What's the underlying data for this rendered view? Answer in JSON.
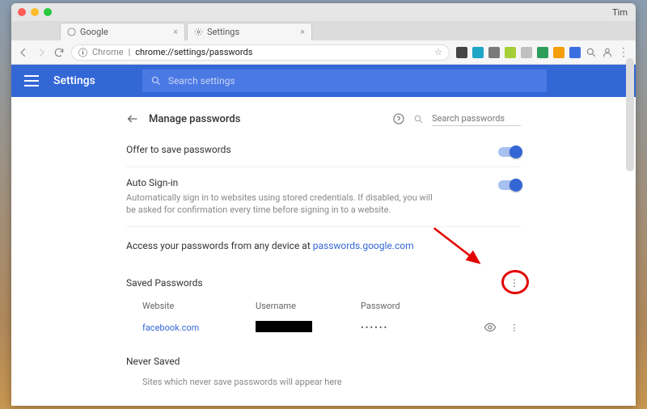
{
  "mac": {
    "user": "Tim"
  },
  "tabs": [
    {
      "label": "Google",
      "icon": "google"
    },
    {
      "label": "Settings",
      "icon": "gear"
    }
  ],
  "addressbar": {
    "scheme": "Chrome",
    "path": "chrome://settings/passwords"
  },
  "header": {
    "title": "Settings",
    "search_placeholder": "Search settings"
  },
  "page": {
    "title": "Manage passwords",
    "search_placeholder": "Search passwords",
    "offer_label": "Offer to save passwords",
    "auto_label": "Auto Sign-in",
    "auto_desc": "Automatically sign in to websites using stored credentials. If disabled, you will be asked for confirmation every time before signing in to a website.",
    "access_prefix": "Access your passwords from any device at ",
    "access_link": "passwords.google.com",
    "saved_label": "Saved Passwords",
    "cols": {
      "site": "Website",
      "user": "Username",
      "pass": "Password"
    },
    "rows": [
      {
        "site": "facebook.com",
        "user_redacted": true,
        "pass_mask": "••••••"
      }
    ],
    "never_label": "Never Saved",
    "never_desc": "Sites which never save passwords will appear here"
  }
}
